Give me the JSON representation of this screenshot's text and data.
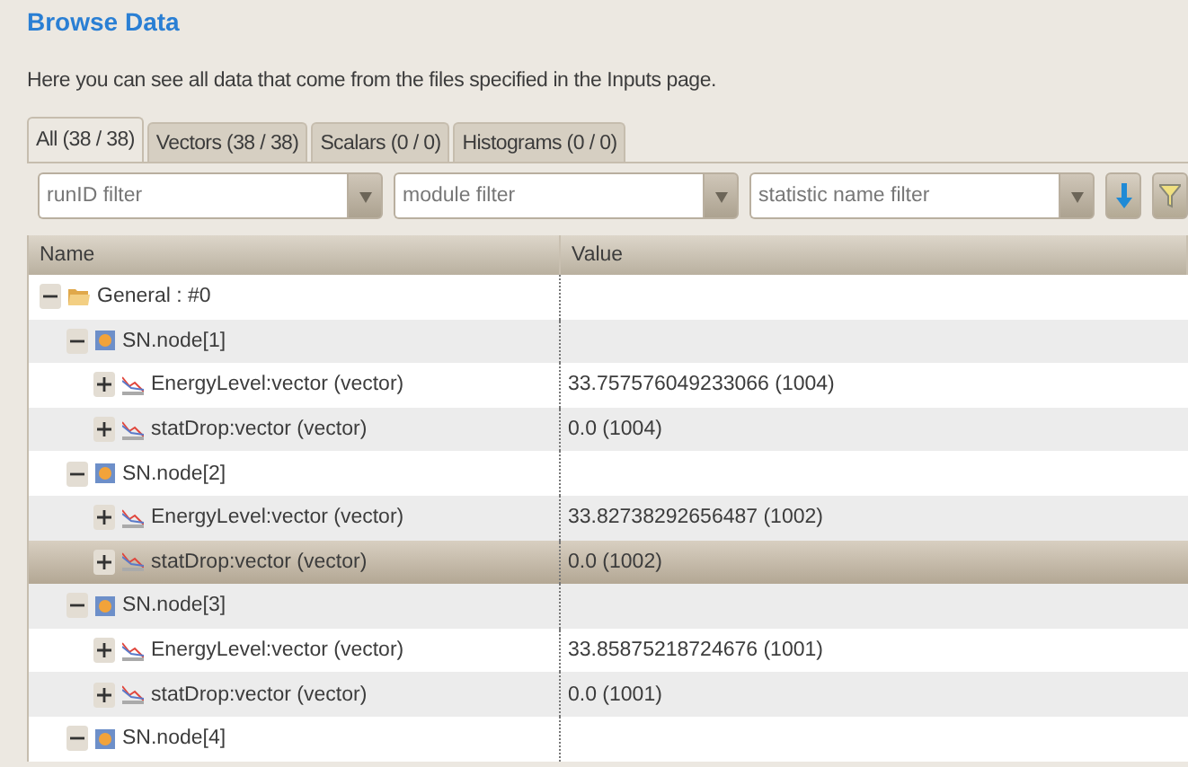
{
  "title": "Browse Data",
  "description": "Here you can see all data that come from the files specified in the Inputs page.",
  "tabs": [
    {
      "label": "All (38 / 38)",
      "selected": true
    },
    {
      "label": "Vectors (38 / 38)",
      "selected": false
    },
    {
      "label": "Scalars (0 / 0)",
      "selected": false
    },
    {
      "label": "Histograms (0 / 0)",
      "selected": false
    }
  ],
  "filters": [
    {
      "placeholder": "runID filter"
    },
    {
      "placeholder": "module filter"
    },
    {
      "placeholder": "statistic name filter"
    }
  ],
  "table": {
    "columns": [
      "Name",
      "Value"
    ],
    "rows": [
      {
        "kind": "folder",
        "name": "General : #0",
        "expanded": true,
        "selected": false,
        "children": [
          {
            "kind": "module",
            "name": "SN.node[1]",
            "expanded": true,
            "selected": false,
            "children": [
              {
                "kind": "vector",
                "name": "EnergyLevel:vector (vector)",
                "value": "33.757576049233066 (1004)",
                "expanded": false,
                "selected": false
              },
              {
                "kind": "vector",
                "name": "statDrop:vector (vector)",
                "value": "0.0 (1004)",
                "expanded": false,
                "selected": false
              }
            ]
          },
          {
            "kind": "module",
            "name": "SN.node[2]",
            "expanded": true,
            "selected": false,
            "children": [
              {
                "kind": "vector",
                "name": "EnergyLevel:vector (vector)",
                "value": "33.82738292656487 (1002)",
                "expanded": false,
                "selected": false
              },
              {
                "kind": "vector",
                "name": "statDrop:vector (vector)",
                "value": "0.0 (1002)",
                "expanded": false,
                "selected": true
              }
            ]
          },
          {
            "kind": "module",
            "name": "SN.node[3]",
            "expanded": true,
            "selected": false,
            "children": [
              {
                "kind": "vector",
                "name": "EnergyLevel:vector (vector)",
                "value": "33.85875218724676 (1001)",
                "expanded": false,
                "selected": false
              },
              {
                "kind": "vector",
                "name": "statDrop:vector (vector)",
                "value": "0.0 (1001)",
                "expanded": false,
                "selected": false
              }
            ]
          },
          {
            "kind": "module",
            "name": "SN.node[4]",
            "expanded": true,
            "selected": false
          }
        ]
      }
    ]
  }
}
